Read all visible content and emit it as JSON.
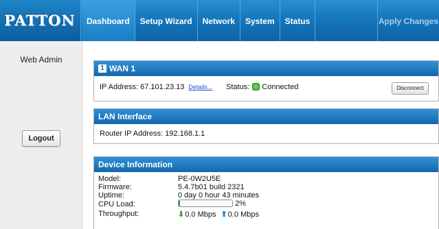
{
  "logo": "PATTON",
  "nav": {
    "dashboard": "Dashboard",
    "setup_wizard": "Setup Wizard",
    "network": "Network",
    "system": "System",
    "status": "Status",
    "apply_changes": "Apply Changes"
  },
  "sidebar": {
    "web_admin": "Web Admin",
    "logout": "Logout"
  },
  "wan": {
    "number": "1",
    "title": "WAN 1",
    "ip_label": "IP Address:",
    "ip_value": "67.101.23.13",
    "details_link": "Details...",
    "status_label": "Status:",
    "status_value": "Connected",
    "status_color": "#2ea81c",
    "disconnect": "Disconnect"
  },
  "lan": {
    "title": "LAN Interface",
    "router_ip_label": "Router IP Address:",
    "router_ip_value": "192.168.1.1"
  },
  "device": {
    "title": "Device Information",
    "model_label": "Model:",
    "model_value": "PE-0W2U5E",
    "firmware_label": "Firmware:",
    "firmware_value": "5.4.7b01 build 2321",
    "uptime_label": "Uptime:",
    "uptime_value": "0 day 0 hour 43 minutes",
    "cpu_label": "CPU Load:",
    "cpu_value": "2%",
    "cpu_fraction": 0.02,
    "throughput_label": "Throughput:",
    "down_value": "0.0 Mbps",
    "up_value": "0.0 Mbps"
  },
  "colors": {
    "accent": "#1577bd",
    "header": "#1467ad",
    "sidebar": "#eeeeee"
  }
}
